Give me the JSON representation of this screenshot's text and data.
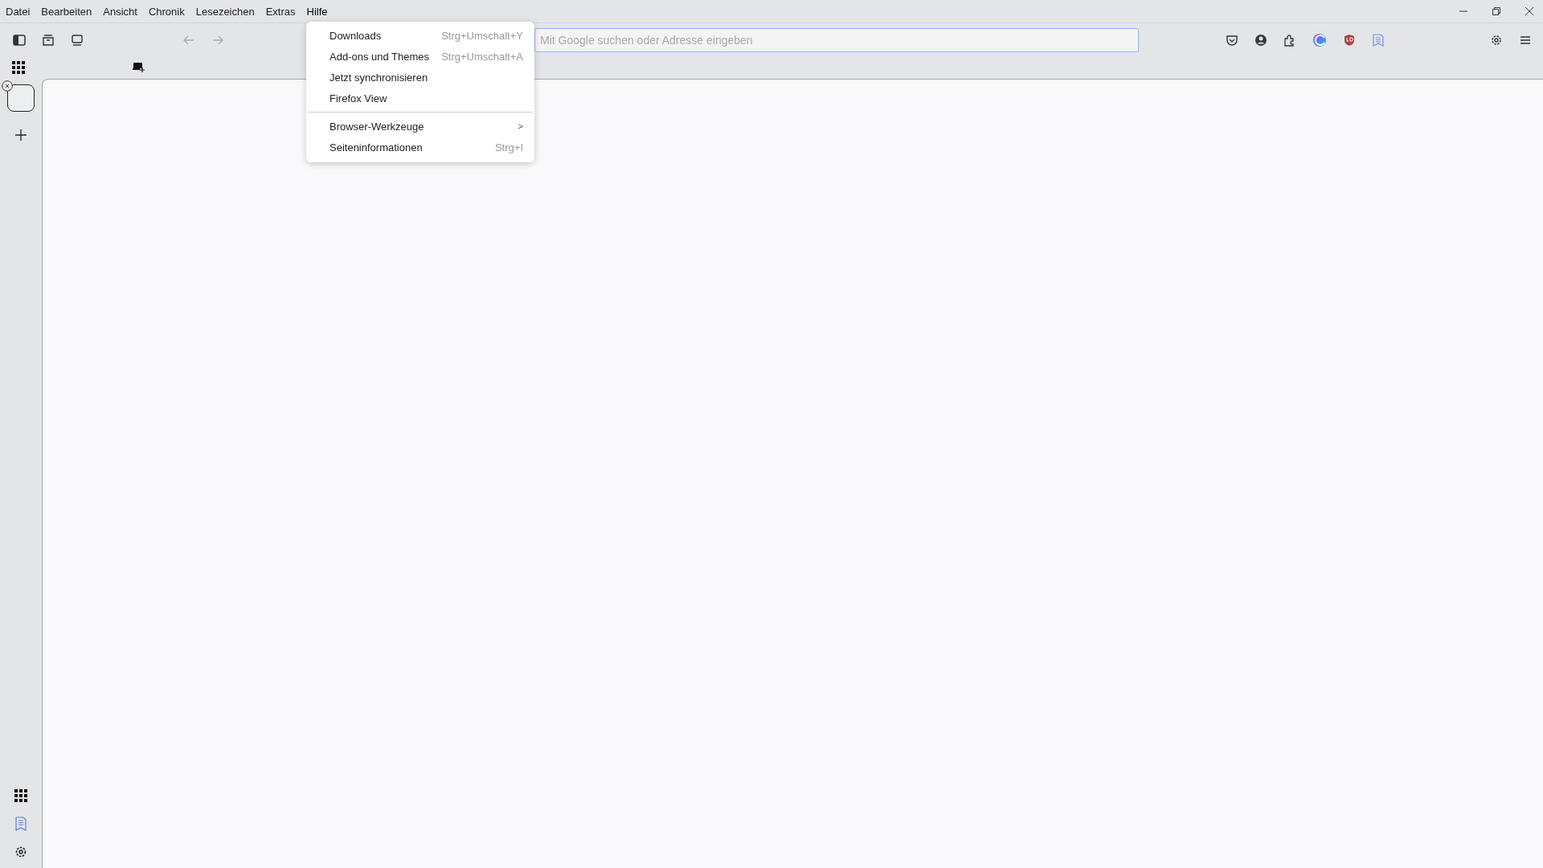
{
  "menu_bar": [
    {
      "label": "Datei",
      "selected": false
    },
    {
      "label": "Bearbeiten",
      "selected": false
    },
    {
      "label": "Ansicht",
      "selected": false
    },
    {
      "label": "Chronik",
      "selected": false
    },
    {
      "label": "Lesezeichen",
      "selected": false
    },
    {
      "label": "Extras",
      "selected": false
    },
    {
      "label": "Hilfe",
      "selected": true
    }
  ],
  "address_bar": {
    "placeholder": "Mit Google suchen oder Adresse eingeben"
  },
  "dropdown_menu": [
    {
      "kind": "item",
      "label": "Downloads",
      "shortcut": "Strg+Umschalt+Y"
    },
    {
      "kind": "item",
      "label": "Add-ons und Themes",
      "shortcut": "Strg+Umschalt+A"
    },
    {
      "kind": "item",
      "label": "Jetzt synchronisieren"
    },
    {
      "kind": "item",
      "label": "Firefox View"
    },
    {
      "kind": "separator"
    },
    {
      "kind": "submenu",
      "label": "Browser-Werkzeuge",
      "arrow": ">"
    },
    {
      "kind": "item",
      "label": "Seiteninformationen",
      "shortcut": "Strg+I"
    }
  ]
}
